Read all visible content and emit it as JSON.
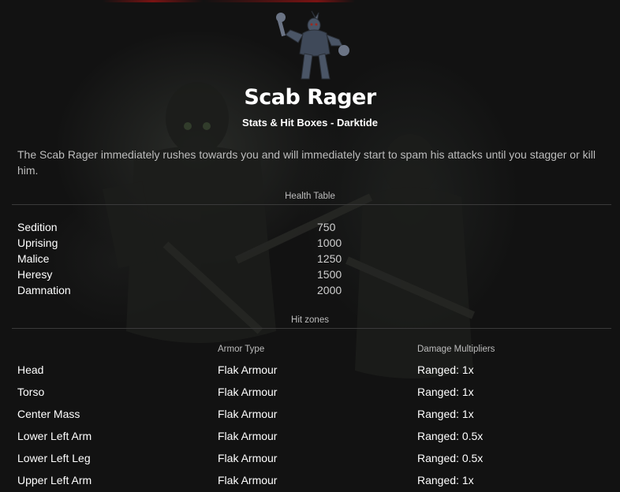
{
  "enemy": {
    "title": "Scab Rager",
    "subtitle": "Stats & Hit Boxes - Darktide",
    "description": "The Scab Rager immediately rushes towards you and will immediately start to spam his attacks until you stagger or kill him."
  },
  "health_table": {
    "title": "Health Table",
    "rows": [
      {
        "difficulty": "Sedition",
        "health": "750"
      },
      {
        "difficulty": "Uprising",
        "health": "1000"
      },
      {
        "difficulty": "Malice",
        "health": "1250"
      },
      {
        "difficulty": "Heresy",
        "health": "1500"
      },
      {
        "difficulty": "Damnation",
        "health": "2000"
      }
    ]
  },
  "hit_zones": {
    "title": "Hit zones",
    "armor_header": "Armor Type",
    "multiplier_header": "Damage Multipliers",
    "rows": [
      {
        "zone": "Head",
        "armor": "Flak Armour",
        "multiplier": "Ranged: 1x"
      },
      {
        "zone": "Torso",
        "armor": "Flak Armour",
        "multiplier": "Ranged: 1x"
      },
      {
        "zone": "Center Mass",
        "armor": "Flak Armour",
        "multiplier": "Ranged: 1x"
      },
      {
        "zone": "Lower Left Arm",
        "armor": "Flak Armour",
        "multiplier": "Ranged: 0.5x"
      },
      {
        "zone": "Lower Left Leg",
        "armor": "Flak Armour",
        "multiplier": "Ranged: 0.5x"
      },
      {
        "zone": "Upper Left Arm",
        "armor": "Flak Armour",
        "multiplier": "Ranged: 1x"
      }
    ]
  },
  "colors": {
    "background": "#121212",
    "text_primary": "#ffffff",
    "text_secondary": "#bdbdbd",
    "divider": "#3a3a3a",
    "accent_red": "#7a1313"
  },
  "icons": {
    "enemy_image": "scab-rager-figure"
  }
}
